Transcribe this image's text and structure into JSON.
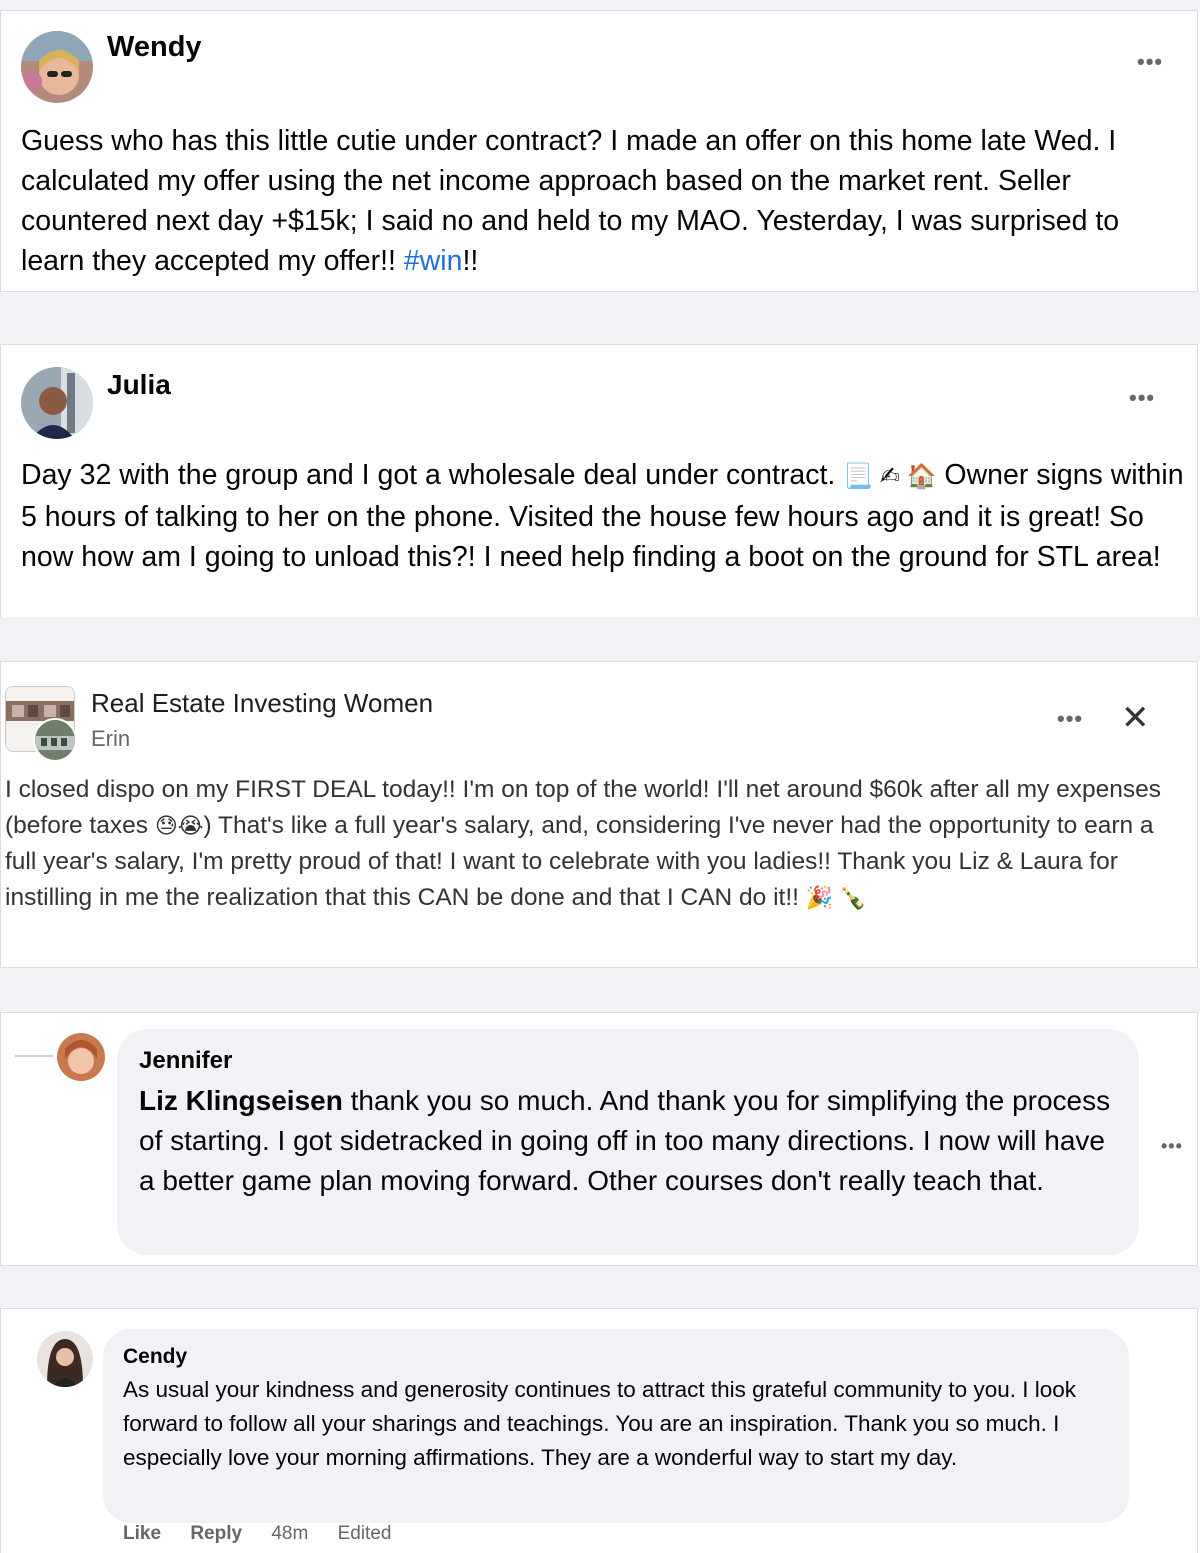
{
  "posts": [
    {
      "author": "Wendy",
      "text": "Guess who has this little cutie under contract?  I made an offer on this home late Wed.  I calculated my offer using the net income approach based on the market rent. Seller countered next day +$15k; I said no and held to my MAO. Yesterday, I was surprised to learn they accepted my offer!! ",
      "hashtag": "#win",
      "text_end": "!!",
      "more_icon": "more-options-icon"
    },
    {
      "author": "Julia",
      "text_before_emoji": "Day 32 with the group and I got a wholesale deal under contract. ",
      "emojis": "📃 ✍ 🏠",
      "text_after_emoji": " Owner signs within 5 hours of talking to her on the phone. Visited the house few hours ago and it is great! So now how am I going to unload this?! I need help finding a boot on the ground for STL area!",
      "more_icon": "more-options-icon"
    },
    {
      "group": "Real Estate Investing Women",
      "author": "Erin",
      "text_1": "I closed dispo on my FIRST DEAL today!! I'm on top of the world! I'll net around $60k after all my expenses (before taxes ",
      "emojis_1": "😓😭",
      "text_2": ") That's like a full year's salary, and, considering I've never had the opportunity to earn a full year's salary, I'm pretty proud of that! I want to celebrate with you ladies!! Thank you Liz & Laura for instilling in me the realization that this CAN be done and that I CAN do it!! ",
      "emojis_2": "🎉 🍾",
      "close_icon": "close-icon"
    }
  ],
  "comments": [
    {
      "author": "Jennifer",
      "mention": "Liz Klingseisen",
      "text": " thank you so much. And thank you for simplifying the process of starting. I got sidetracked in going off in too many directions. I now will have a better game plan moving forward. Other courses don't really teach that."
    },
    {
      "author": "Cendy",
      "text": "As usual your kindness and generosity continues to attract this grateful community to you. I look forward to follow all your sharings and teachings. You are an inspiration. Thank you so much. I especially love your morning affirmations. They are a wonderful way to start my day.",
      "actions": {
        "like": "Like",
        "reply": "Reply",
        "time": "48m",
        "edited": "Edited"
      }
    }
  ],
  "ui": {
    "more": "•••",
    "close": "✕"
  },
  "colors": {
    "hashtag": "#216fdb",
    "bubble": "#f0f2f5",
    "meta": "#65676b"
  }
}
